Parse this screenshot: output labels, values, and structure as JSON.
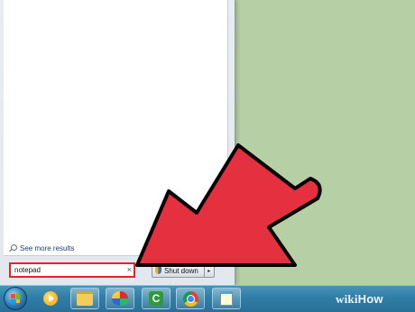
{
  "start_menu": {
    "see_more_label": "See more results",
    "search": {
      "value": "notepad",
      "clear_glyph": "×"
    },
    "shutdown": {
      "label": "Shut down",
      "arrow_glyph": "▸"
    }
  },
  "taskbar": {
    "icons": [
      "windows-orb-icon",
      "media-player-icon",
      "file-explorer-icon",
      "paint-icon",
      "camtasia-icon",
      "chrome-icon",
      "notepad-icon"
    ],
    "camtasia_glyph": "C"
  },
  "watermark": {
    "wiki": "wiki",
    "how": "How"
  },
  "colors": {
    "desktop": "#b7cfa4",
    "arrow_fill": "#e5303f",
    "arrow_stroke": "#000000",
    "search_highlight": "#e8222d"
  }
}
